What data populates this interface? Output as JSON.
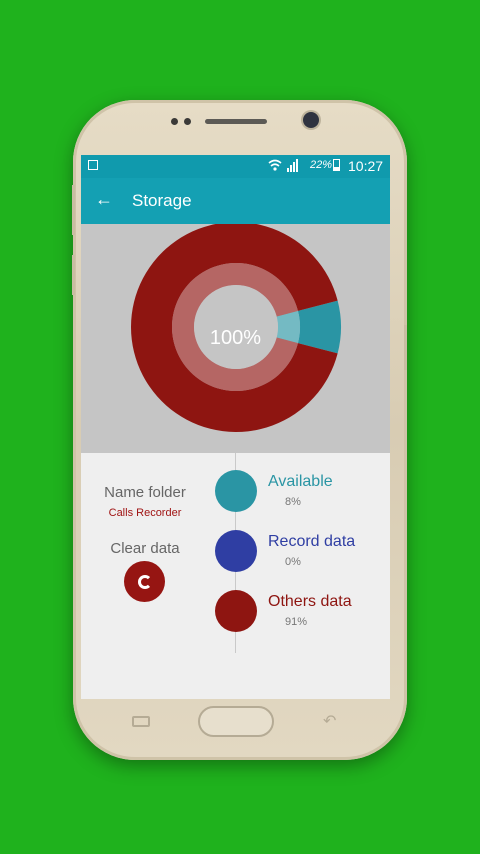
{
  "status_bar": {
    "battery": "22%",
    "time": "10:27"
  },
  "app_bar": {
    "title": "Storage",
    "back_icon": "arrow-left-icon"
  },
  "chart_data": {
    "type": "pie",
    "center_label": "100%",
    "slices": [
      {
        "name": "Available",
        "value": 8,
        "color": "#2a95a4"
      },
      {
        "name": "Record data",
        "value": 0,
        "color": "#2f3ea3"
      },
      {
        "name": "Others data",
        "value": 91,
        "color": "#8e1511"
      }
    ]
  },
  "info": {
    "name_folder_label": "Name folder",
    "name_folder_value": "Calls Recorder",
    "clear_data_label": "Clear data",
    "clear_icon": "clean-icon"
  },
  "legend": [
    {
      "name": "Available",
      "pct": "8%",
      "color": "#2a95a4"
    },
    {
      "name": "Record data",
      "pct": "0%",
      "color": "#2f3ea3"
    },
    {
      "name": "Others data",
      "pct": "91%",
      "color": "#8e1511"
    }
  ],
  "nav_bar": {
    "recent_icon": "recent-apps-icon",
    "home_icon": "home-button",
    "back_icon": "back-icon"
  }
}
